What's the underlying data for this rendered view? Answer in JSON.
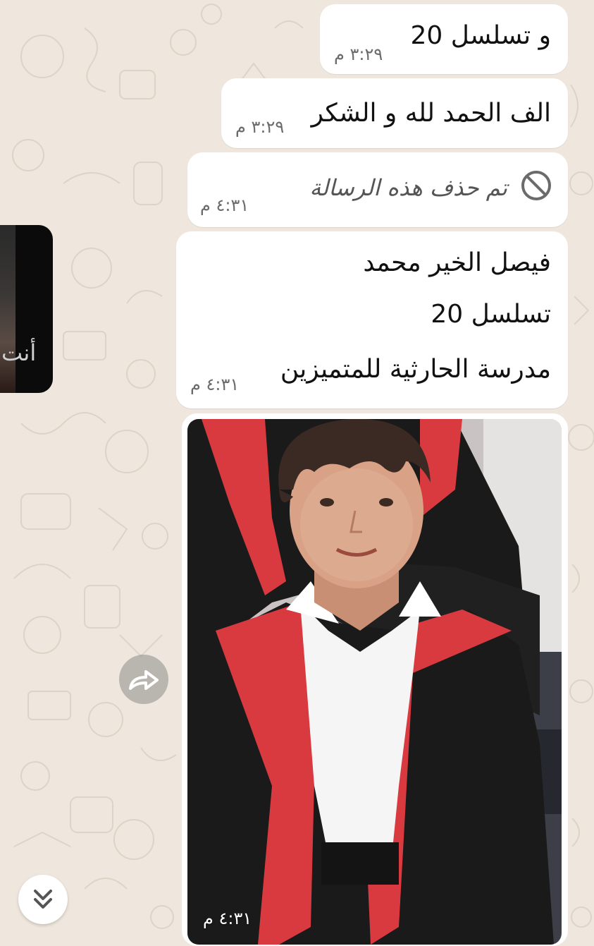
{
  "messages": [
    {
      "text": "و تسلسل 20",
      "time": "٣:٢٩ م"
    },
    {
      "text": "الف الحمد لله و الشكر",
      "time": "٣:٢٩ م"
    },
    {
      "deleted_text": "تم حذف هذه الرسالة",
      "time": "٤:٣١ م"
    },
    {
      "lines": [
        "فيصل الخير محمد",
        "تسلسل 20",
        "مدرسة الحارثية للمتميزين"
      ],
      "time": "٤:٣١ م"
    },
    {
      "photo_time": "٤:٣١ م"
    }
  ],
  "left_card": {
    "label": "أنت"
  },
  "icons": {
    "deleted": "block-icon",
    "forward": "forward-icon",
    "scroll_down": "double-chevron-down-icon"
  },
  "colors": {
    "chat_background": "#efe7dd",
    "bubble": "#ffffff",
    "text": "#111111",
    "timestamp": "#6b6b6b",
    "gown_red": "#d83a3f",
    "gown_black": "#1a1a1a"
  }
}
